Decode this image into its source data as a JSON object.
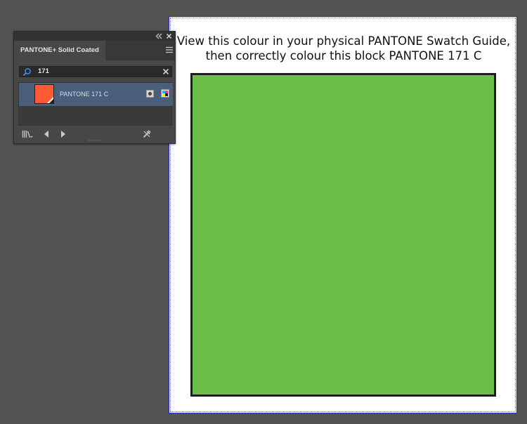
{
  "swatch_panel": {
    "tab_title": "PANTONE+ Solid Coated",
    "search": {
      "value": "171"
    },
    "results": [
      {
        "name": "PANTONE 171 C",
        "color": "#ff5a36"
      }
    ],
    "header_icons": [
      "collapse-icon",
      "close-icon"
    ],
    "footer_icons": [
      "swatch-libraries-menu-icon",
      "previous-library-icon",
      "next-library-icon",
      "swatch-tools-icon"
    ]
  },
  "artboard": {
    "instruction_line1": "View this colour in your physical PANTONE Swatch Guide,",
    "instruction_line2": "then correctly colour this block PANTONE 171 C",
    "block_color": "#6cbe4b",
    "block_border_color": "#1e1e1e"
  },
  "colors": {
    "workspace_bg": "#535353",
    "panel_bg": "#474747",
    "selection_row": "#4a5f7b",
    "artboard_border": "#2a2ab8"
  }
}
